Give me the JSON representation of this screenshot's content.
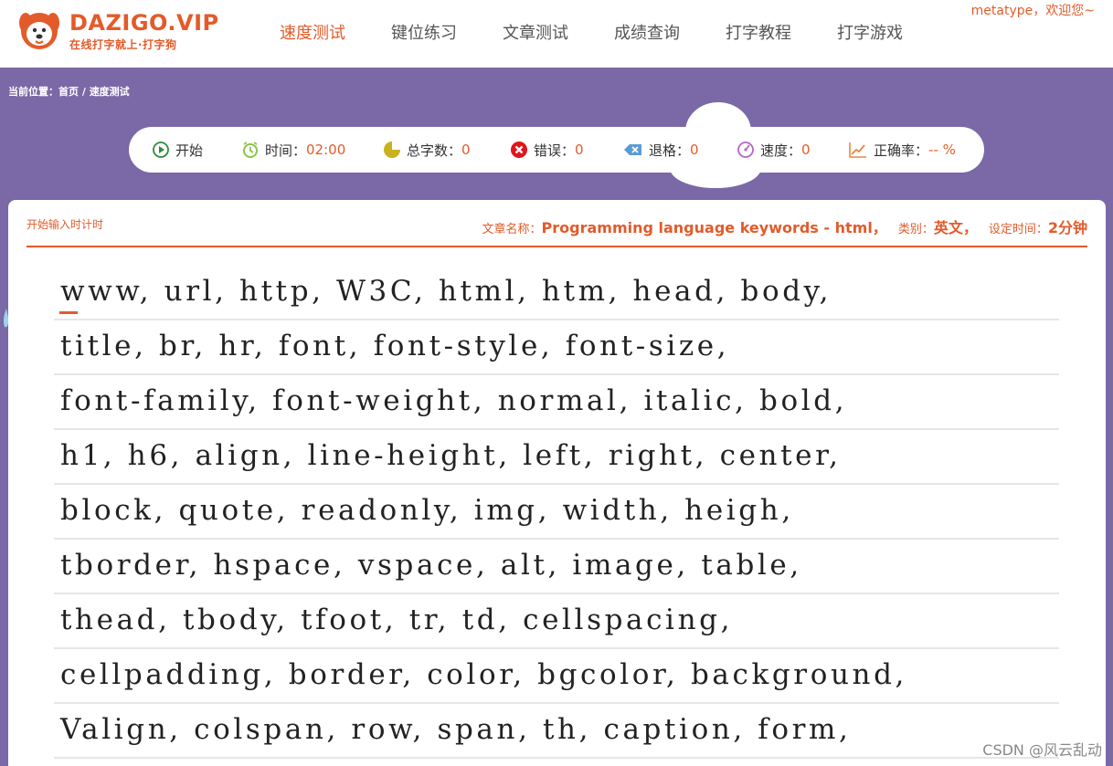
{
  "header": {
    "logo_title": "DAZIGO.VIP",
    "logo_subtitle": "在线打字就上·打字狗",
    "user_greeting": "metatype，欢迎您~"
  },
  "nav": [
    {
      "label": "速度测试",
      "active": true
    },
    {
      "label": "键位练习",
      "active": false
    },
    {
      "label": "文章测试",
      "active": false
    },
    {
      "label": "成绩查询",
      "active": false
    },
    {
      "label": "打字教程",
      "active": false
    },
    {
      "label": "打字游戏",
      "active": false
    }
  ],
  "breadcrumb": {
    "prefix": "当前位置：",
    "home": "首页",
    "separator": " / ",
    "current": "速度测试"
  },
  "toolbar": {
    "start_label": "开始",
    "time_label": "时间：",
    "time_value": "02:00",
    "total_label": "总字数：",
    "total_value": "0",
    "errors_label": "错误：",
    "errors_value": "0",
    "backspace_label": "退格：",
    "backspace_value": "0",
    "speed_label": "速度：",
    "speed_value": "0",
    "accuracy_label": "正确率：",
    "accuracy_value": "-- %"
  },
  "card": {
    "start_hint": "开始输入时计时",
    "article_name_label": "文章名称：",
    "article_name": "Programming language keywords - html，",
    "category_label": "类别：",
    "category": "英文，",
    "time_setting_label": "设定时间：",
    "time_setting": "2分钟"
  },
  "lines": [
    "www, url, http, W3C, html, htm, head, body,",
    "title, br, hr, font, font-style, font-size,",
    "font-family, font-weight, normal, italic, bold,",
    "h1, h6, align, line-height, left, right, center,",
    "block, quote, readonly, img, width, heigh,",
    "tborder, hspace, vspace, alt, image, table,",
    "thead, tbody, tfoot, tr, td, cellspacing,",
    "cellpadding, border, color, bgcolor, background,",
    "Valign, colspan, row, span, th, caption, form,"
  ],
  "watermark": "CSDN @风云乱动",
  "colors": {
    "accent": "#e35b2a",
    "page_background": "#7b68a6",
    "text": "#222222"
  },
  "icons": {
    "start": "play-icon",
    "time": "clock-icon",
    "total": "pie-icon",
    "errors": "error-icon",
    "backspace": "backspace-icon",
    "speed": "speedometer-icon",
    "accuracy": "chart-line-icon"
  }
}
